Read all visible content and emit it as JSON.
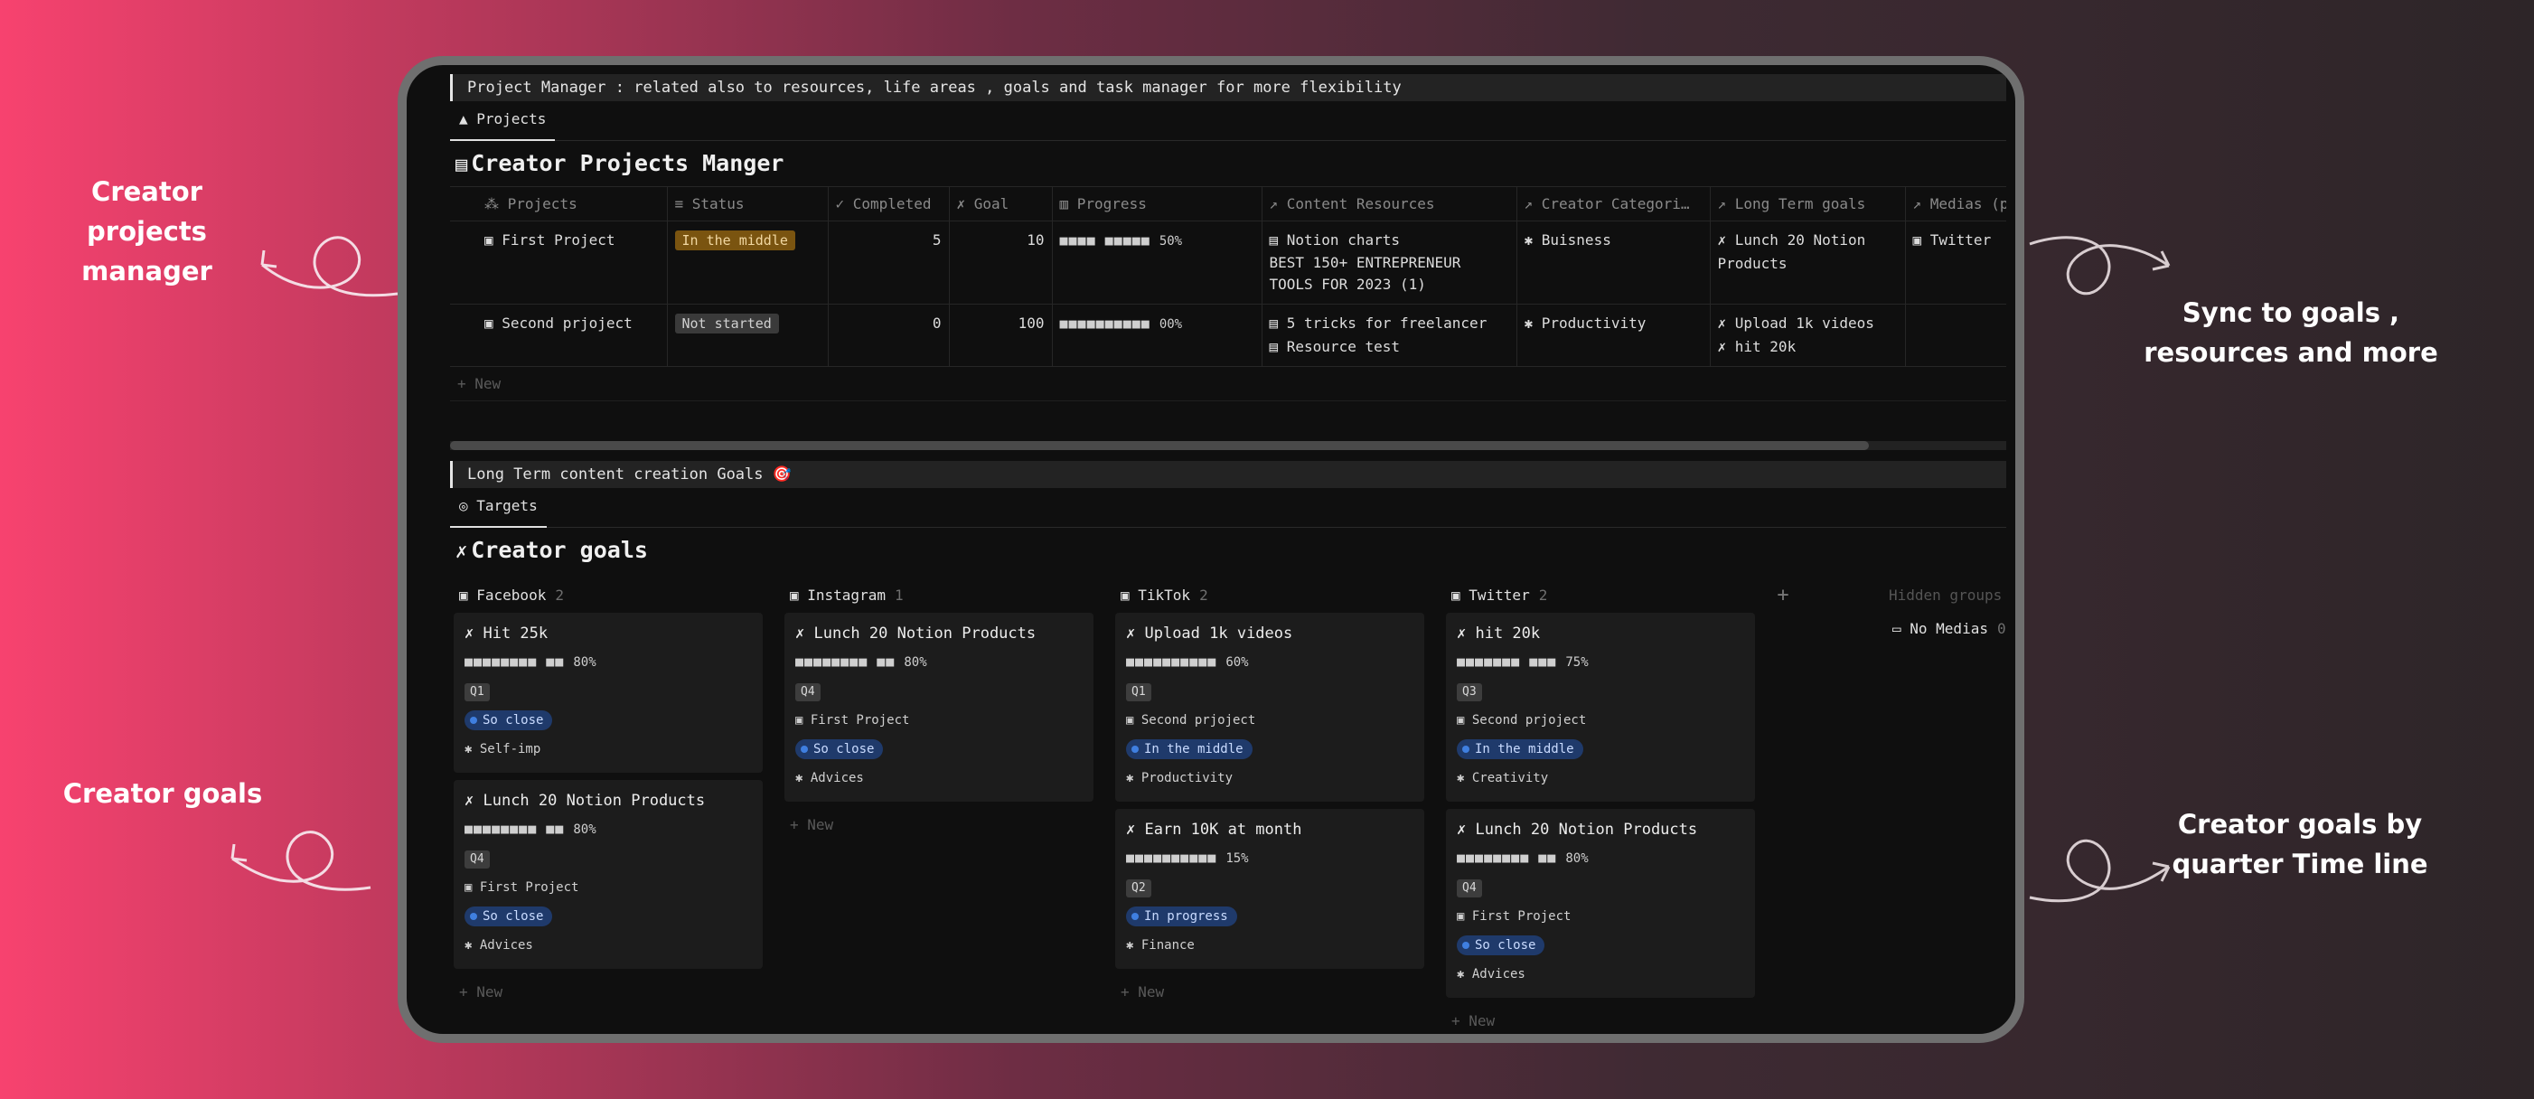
{
  "callouts": {
    "projects_manager": "Creator projects manager",
    "sync": "Sync to goals , resources and more",
    "goals": "Creator goals",
    "timeline": "Creator goals by quarter Time line"
  },
  "project_section": {
    "callout": "Project Manager : related also to resources, life areas , goals and task manager for more flexibility",
    "tab": "Projects",
    "title": "Creator Projects Manger",
    "columns": [
      "Projects",
      "Status",
      "Completed",
      "Goal",
      "Progress",
      "Content Resources",
      "Creator Categori…",
      "Long Term goals",
      "Medias (p"
    ],
    "rows": [
      {
        "name": "First Project",
        "status": "In the middle",
        "completed": "5",
        "goal": "10",
        "progress_bar": "■■■■ ■■■■■",
        "progress_pct": "50%",
        "resource_1": "Notion charts",
        "resource_2": "BEST 150+ ENTREPRENEUR TOOLS FOR 2023 (1)",
        "category": "Buisness",
        "long_goal_1": "Lunch 20 Notion Products",
        "long_goal_2": "",
        "media": "Twitter"
      },
      {
        "name": "Second prjoject",
        "status": "Not started",
        "completed": "0",
        "goal": "100",
        "progress_bar": "■■■■■■■■■■",
        "progress_pct": "00%",
        "resource_1": "5 tricks for freelancer",
        "resource_2": "Resource test",
        "category": "Productivity",
        "long_goal_1": "Upload 1k videos",
        "long_goal_2": "hit 20k",
        "media": ""
      }
    ],
    "new_label": "+ New"
  },
  "goals_section": {
    "callout": "Long Term content creation Goals 🎯",
    "tab": "Targets",
    "title": "Creator goals",
    "hidden_groups": "Hidden groups",
    "no_medias": "No Medias",
    "no_medias_count": "0",
    "new_label": "+ New",
    "columns": [
      {
        "name": "Facebook",
        "count": "2",
        "cards": [
          {
            "title": "Hit 25k",
            "bar": "■■■■■■■■ ■■",
            "pct": "80%",
            "quarter": "Q1",
            "project": "",
            "status": "So close",
            "category": "Self-imp"
          },
          {
            "title": "Lunch 20 Notion Products",
            "bar": "■■■■■■■■ ■■",
            "pct": "80%",
            "quarter": "Q4",
            "project": "First Project",
            "status": "So close",
            "category": "Advices"
          }
        ]
      },
      {
        "name": "Instagram",
        "count": "1",
        "cards": [
          {
            "title": "Lunch 20 Notion Products",
            "bar": "■■■■■■■■ ■■",
            "pct": "80%",
            "quarter": "Q4",
            "project": "First Project",
            "status": "So close",
            "category": "Advices"
          }
        ]
      },
      {
        "name": "TikTok",
        "count": "2",
        "cards": [
          {
            "title": "Upload 1k videos",
            "bar": "■■■■■■■■■■",
            "pct": "60%",
            "quarter": "Q1",
            "project": "Second prjoject",
            "status": "In the middle",
            "category": "Productivity"
          },
          {
            "title": "Earn 10K at month",
            "bar": "■■■■■■■■■■",
            "pct": "15%",
            "quarter": "Q2",
            "project": "",
            "status": "In progress",
            "category": "Finance"
          }
        ]
      },
      {
        "name": "Twitter",
        "count": "2",
        "cards": [
          {
            "title": "hit 20k",
            "bar": "■■■■■■■ ■■■",
            "pct": "75%",
            "quarter": "Q3",
            "project": "Second prjoject",
            "status": "In the middle",
            "category": "Creativity"
          },
          {
            "title": "Lunch 20 Notion Products",
            "bar": "■■■■■■■■ ■■",
            "pct": "80%",
            "quarter": "Q4",
            "project": "First Project",
            "status": "So close",
            "category": "Advices"
          }
        ]
      }
    ]
  }
}
